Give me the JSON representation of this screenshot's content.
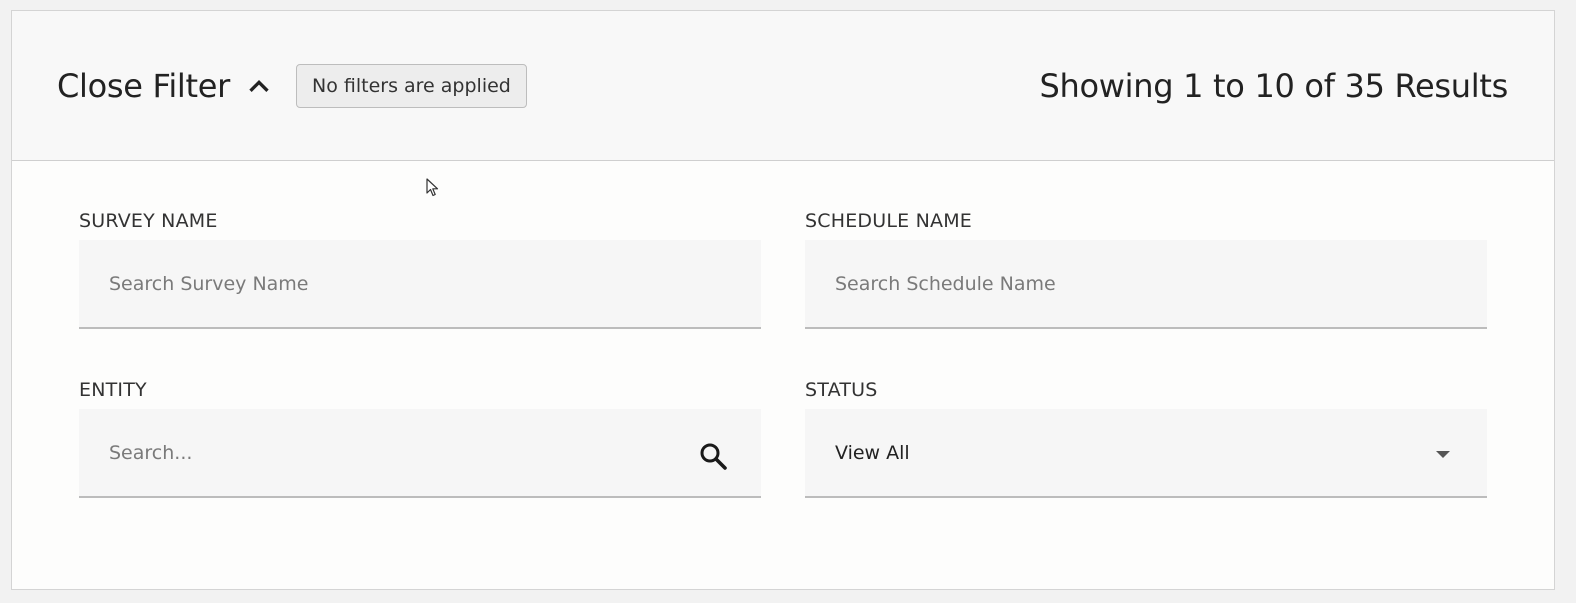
{
  "header": {
    "toggle_label": "Close Filter",
    "toggle_icon": "chevron-up-icon",
    "filter_status": "No filters are applied",
    "results_text": "Showing 1 to 10 of 35 Results"
  },
  "filters": {
    "survey_name": {
      "label": "SURVEY NAME",
      "placeholder": "Search Survey Name",
      "value": ""
    },
    "schedule_name": {
      "label": "SCHEDULE NAME",
      "placeholder": "Search Schedule Name",
      "value": ""
    },
    "entity": {
      "label": "ENTITY",
      "placeholder": "Search...",
      "value": "",
      "icon": "search-icon"
    },
    "status": {
      "label": "STATUS",
      "selected": "View All",
      "icon": "caret-down-icon"
    }
  }
}
